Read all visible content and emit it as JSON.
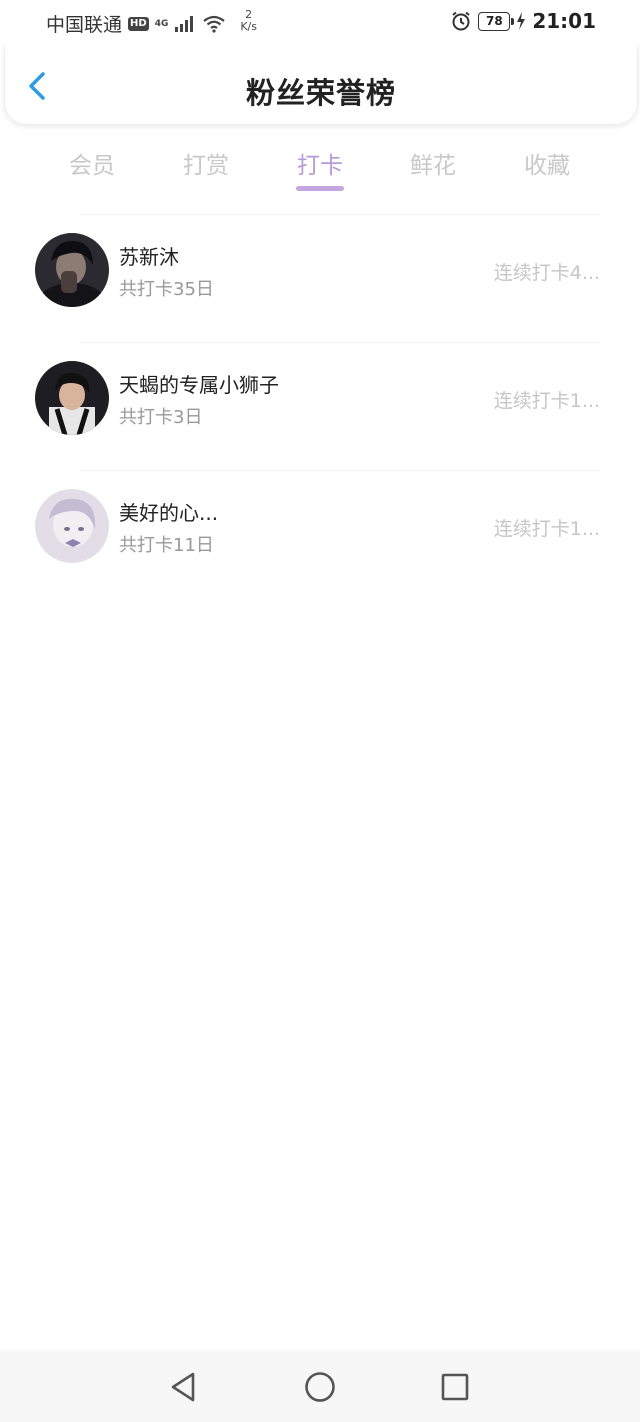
{
  "status_bar": {
    "carrier": "中国联通",
    "hd": "HD",
    "network": "4G",
    "speed_value": "2",
    "speed_unit": "K/s",
    "battery": "78",
    "time": "21:01",
    "icons": [
      "signal-icon",
      "wifi-icon",
      "alarm-icon",
      "battery-icon",
      "charging-icon"
    ]
  },
  "header": {
    "title": "粉丝荣誉榜",
    "back_icon": "chevron-left-icon",
    "accent_color": "#2e9be6"
  },
  "tabs": [
    {
      "label": "会员",
      "active": false
    },
    {
      "label": "打赏",
      "active": false
    },
    {
      "label": "打卡",
      "active": true
    },
    {
      "label": "鲜花",
      "active": false
    },
    {
      "label": "收藏",
      "active": false
    }
  ],
  "active_color": "#b99ad8",
  "fans": [
    {
      "name": "苏新沐",
      "total": "共打卡35日",
      "streak": "连续打卡4..."
    },
    {
      "name": "天蝎的专属小狮子",
      "total": "共打卡3日",
      "streak": "连续打卡1..."
    },
    {
      "name": "美好的心...",
      "total": "共打卡11日",
      "streak": "连续打卡1..."
    }
  ],
  "navbar": {
    "icons": [
      "back-triangle-icon",
      "home-circle-icon",
      "recents-square-icon"
    ]
  }
}
